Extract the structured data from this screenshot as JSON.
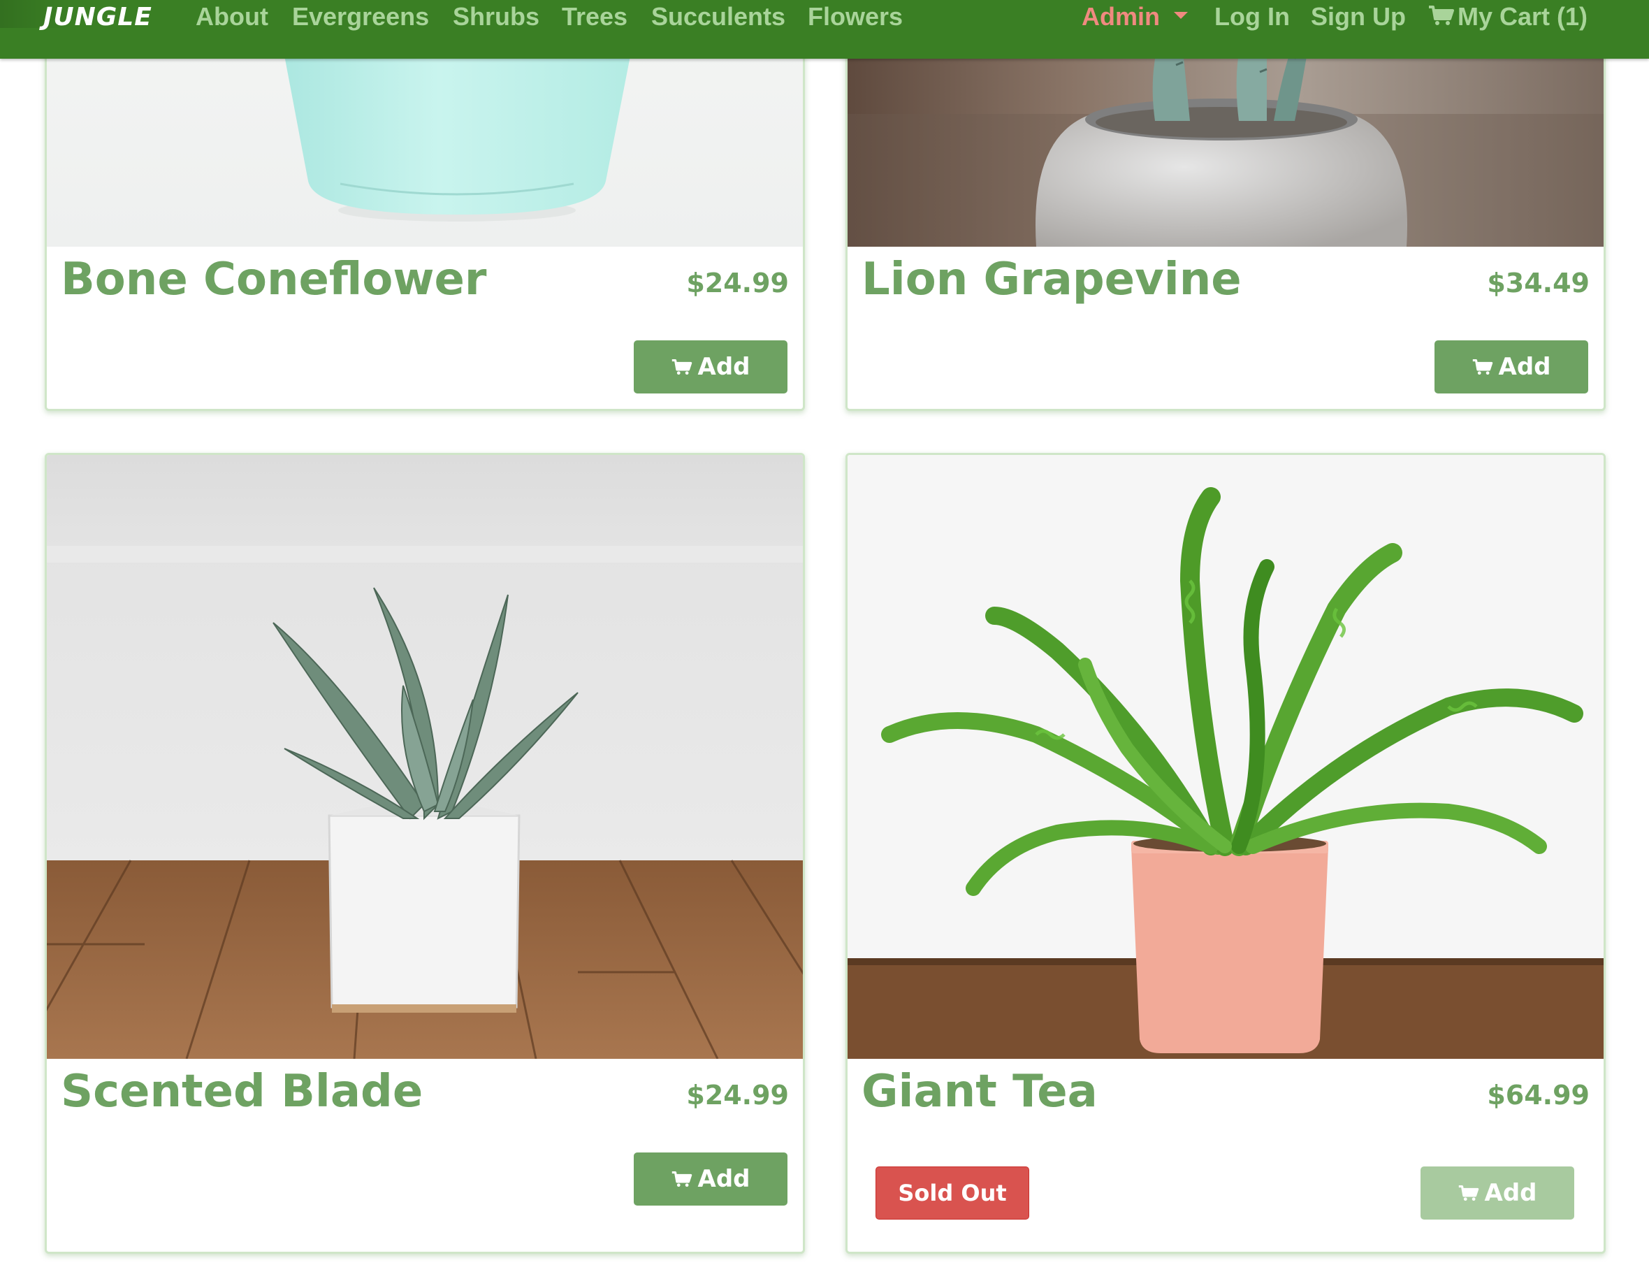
{
  "nav": {
    "brand": "JUNGLE",
    "links": [
      "About",
      "Evergreens",
      "Shrubs",
      "Trees",
      "Succulents",
      "Flowers"
    ],
    "admin": "Admin",
    "login": "Log In",
    "signup": "Sign Up",
    "cart": "My Cart (1)"
  },
  "products": [
    {
      "name": "Bone Coneflower",
      "price": "$24.99",
      "add_label": "Add"
    },
    {
      "name": "Lion Grapevine",
      "price": "$34.49",
      "add_label": "Add"
    },
    {
      "name": "Scented Blade",
      "price": "$24.99",
      "add_label": "Add"
    },
    {
      "name": "Giant Tea",
      "price": "$64.99",
      "add_label": "Add",
      "sold_out_label": "Sold Out"
    }
  ],
  "icons": {
    "cart": "shopping-cart-icon",
    "caret": "caret-down-icon"
  },
  "colors": {
    "navbar": "#3a7f24",
    "nav_link": "#a9d49a",
    "admin_link": "#f08a80",
    "accent_green": "#6ea262",
    "button_disabled": "#a8ca9f",
    "sold_out": "#d9534f"
  }
}
